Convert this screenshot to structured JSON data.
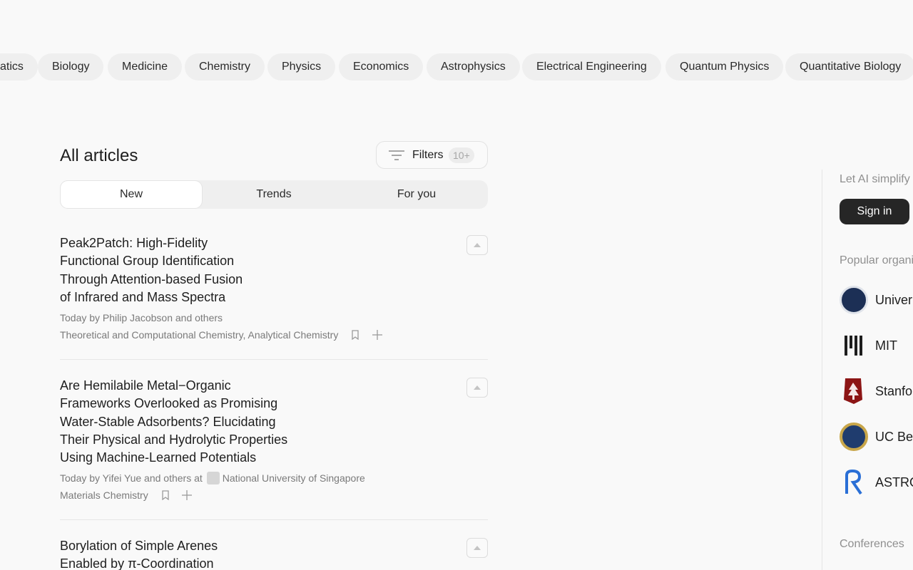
{
  "categories": [
    "atics",
    "Biology",
    "Medicine",
    "Chemistry",
    "Physics",
    "Economics",
    "Astrophysics",
    "Electrical Engineering",
    "Quantum Physics",
    "Quantitative Biology"
  ],
  "header": {
    "title": "All articles",
    "filters_label": "Filters",
    "filters_count": "10+"
  },
  "tabs": [
    "New",
    "Trends",
    "For you"
  ],
  "articles": [
    {
      "title_lines": [
        "Peak2Patch: High-Fidelity",
        "Functional Group Identification",
        "Through Attention-based Fusion",
        "of Infrared and Mass Spectra"
      ],
      "meta": "Today by Philip Jacobson and others",
      "categories": "Theoretical and Computational Chemistry, Analytical Chemistry"
    },
    {
      "title_lines": [
        "Are Hemilabile Metal−Organic",
        "Frameworks Overlooked as Promising",
        "Water-Stable Adsorbents? Elucidating",
        "Their Physical and Hydrolytic Properties",
        "Using Machine-Learned Potentials"
      ],
      "meta": "Today by Yifei Yue and others at",
      "institution": "National University of Singapore",
      "categories": "Materials Chemistry"
    },
    {
      "title_lines": [
        "Borylation of Simple Arenes",
        "Enabled by π-Coordination"
      ]
    }
  ],
  "sidebar": {
    "promo": "Let AI simplify",
    "signin": "Sign in",
    "popular_heading": "Popular organi",
    "orgs": [
      {
        "name": "Univer",
        "logo": "university-seal-icon"
      },
      {
        "name": "MIT",
        "logo": "mit-logo-icon"
      },
      {
        "name": "Stanfo",
        "logo": "stanford-tree-icon"
      },
      {
        "name": "UC Be",
        "logo": "uc-berkeley-seal-icon"
      },
      {
        "name": "ASTRO",
        "logo": "astro-r-logo-icon"
      }
    ],
    "conferences_heading": "Conferences"
  },
  "colors": {
    "accent": "#262626",
    "chip_bg": "#efefef",
    "muted_text": "#7a7a7a"
  }
}
